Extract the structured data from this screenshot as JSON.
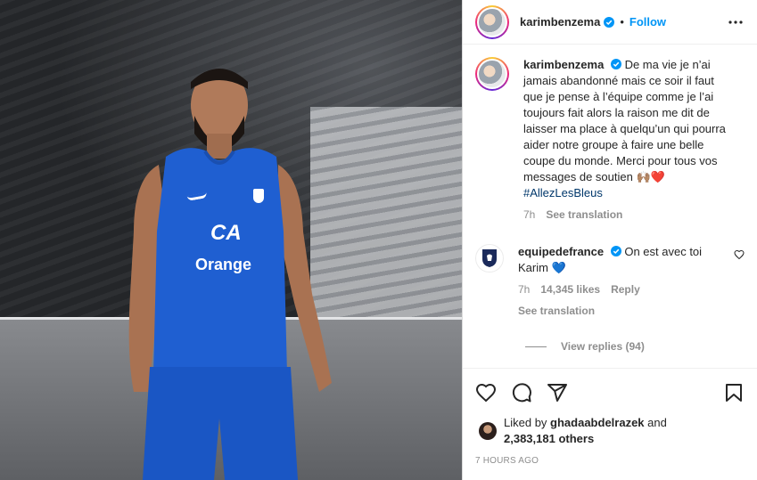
{
  "header": {
    "username": "karimbenzema",
    "separator": "•",
    "follow_label": "Follow"
  },
  "caption": {
    "username": "karimbenzema",
    "text": "De ma vie je n’ai jamais abandonné mais ce soir il faut que je pense à l’équipe comme je l’ai toujours fait alors la raison me dit de laisser ma place à quelqu’un qui pourra aider notre groupe à faire une belle coupe du monde. Merci pour tous vos messages de soutien 🙌🏽❤️",
    "hashtag": "#AllezLesBleus",
    "time": "7h",
    "see_translation": "See translation"
  },
  "comment": {
    "username": "equipedefrance",
    "text": "On est avec toi Karim 💙",
    "time": "7h",
    "likes": "14,345 likes",
    "reply_label": "Reply",
    "see_translation": "See translation",
    "view_replies": "View replies (94)"
  },
  "likes": {
    "prefix": "Liked by",
    "liker": "ghadaabdelrazek",
    "and": "and",
    "others": "2,383,181 others"
  },
  "timestamp": "7 HOURS AGO",
  "photo": {
    "jersey_sponsor": "Orange",
    "jersey_logo": "CA"
  },
  "icons": {
    "verified": "verified-badge-icon",
    "more": "more-options-icon",
    "like": "heart-icon",
    "comment": "comment-icon",
    "share": "paper-plane-icon",
    "save": "bookmark-icon"
  },
  "colors": {
    "accent": "#0095f6",
    "jersey": "#1f5fd1",
    "muted": "#8e8e8e",
    "hashtag": "#00376b"
  }
}
